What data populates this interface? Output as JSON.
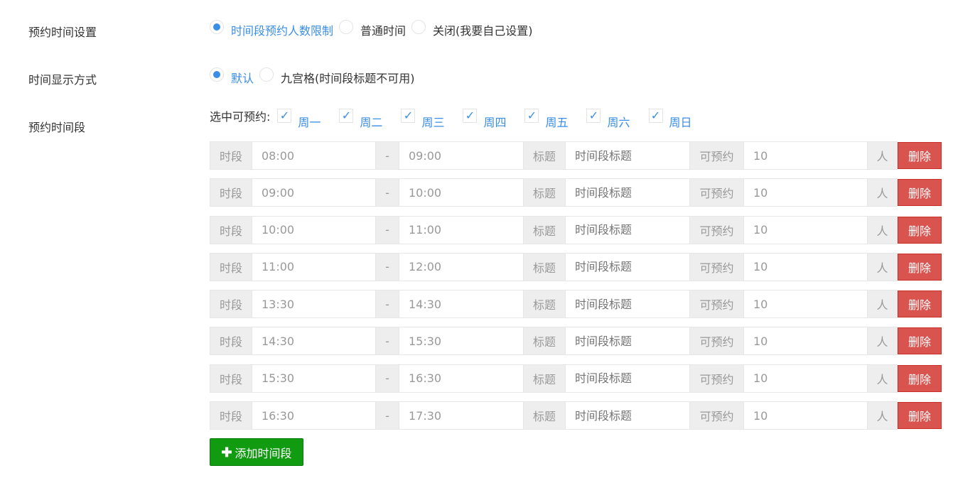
{
  "settings": {
    "booking_time_label": "预约时间设置",
    "booking_time_options": [
      {
        "label": "时间段预约人数限制",
        "selected": true
      },
      {
        "label": "普通时间",
        "selected": false
      },
      {
        "label": "关闭(我要自己设置)",
        "selected": false
      }
    ],
    "display_mode_label": "时间显示方式",
    "display_mode_options": [
      {
        "label": "默认",
        "selected": true
      },
      {
        "label": "九宫格(时间段标题不可用)",
        "selected": false
      }
    ],
    "slots_label": "预约时间段"
  },
  "weekdays": {
    "prefix": "选中可预约:",
    "check_mark": "✓",
    "days": [
      {
        "label": "周一",
        "checked": true
      },
      {
        "label": "周二",
        "checked": true
      },
      {
        "label": "周三",
        "checked": true
      },
      {
        "label": "周四",
        "checked": true
      },
      {
        "label": "周五",
        "checked": true
      },
      {
        "label": "周六",
        "checked": true
      },
      {
        "label": "周日",
        "checked": true
      }
    ]
  },
  "slot_labels": {
    "period": "时段",
    "dash": "-",
    "title": "标题",
    "title_placeholder": "时间段标题",
    "bookable": "可预约",
    "person": "人",
    "delete": "删除"
  },
  "slots": [
    {
      "start": "08:00",
      "end": "09:00",
      "count": "10"
    },
    {
      "start": "09:00",
      "end": "10:00",
      "count": "10"
    },
    {
      "start": "10:00",
      "end": "11:00",
      "count": "10"
    },
    {
      "start": "11:00",
      "end": "12:00",
      "count": "10"
    },
    {
      "start": "13:30",
      "end": "14:30",
      "count": "10"
    },
    {
      "start": "14:30",
      "end": "15:30",
      "count": "10"
    },
    {
      "start": "15:30",
      "end": "16:30",
      "count": "10"
    },
    {
      "start": "16:30",
      "end": "17:30",
      "count": "10"
    }
  ],
  "add_button": {
    "icon": "plus-icon",
    "plus_glyph": "✚",
    "label": "添加时间段"
  },
  "colors": {
    "accent_blue": "#3a8ee6",
    "delete_red": "#d9534f",
    "add_green": "#119b11"
  }
}
